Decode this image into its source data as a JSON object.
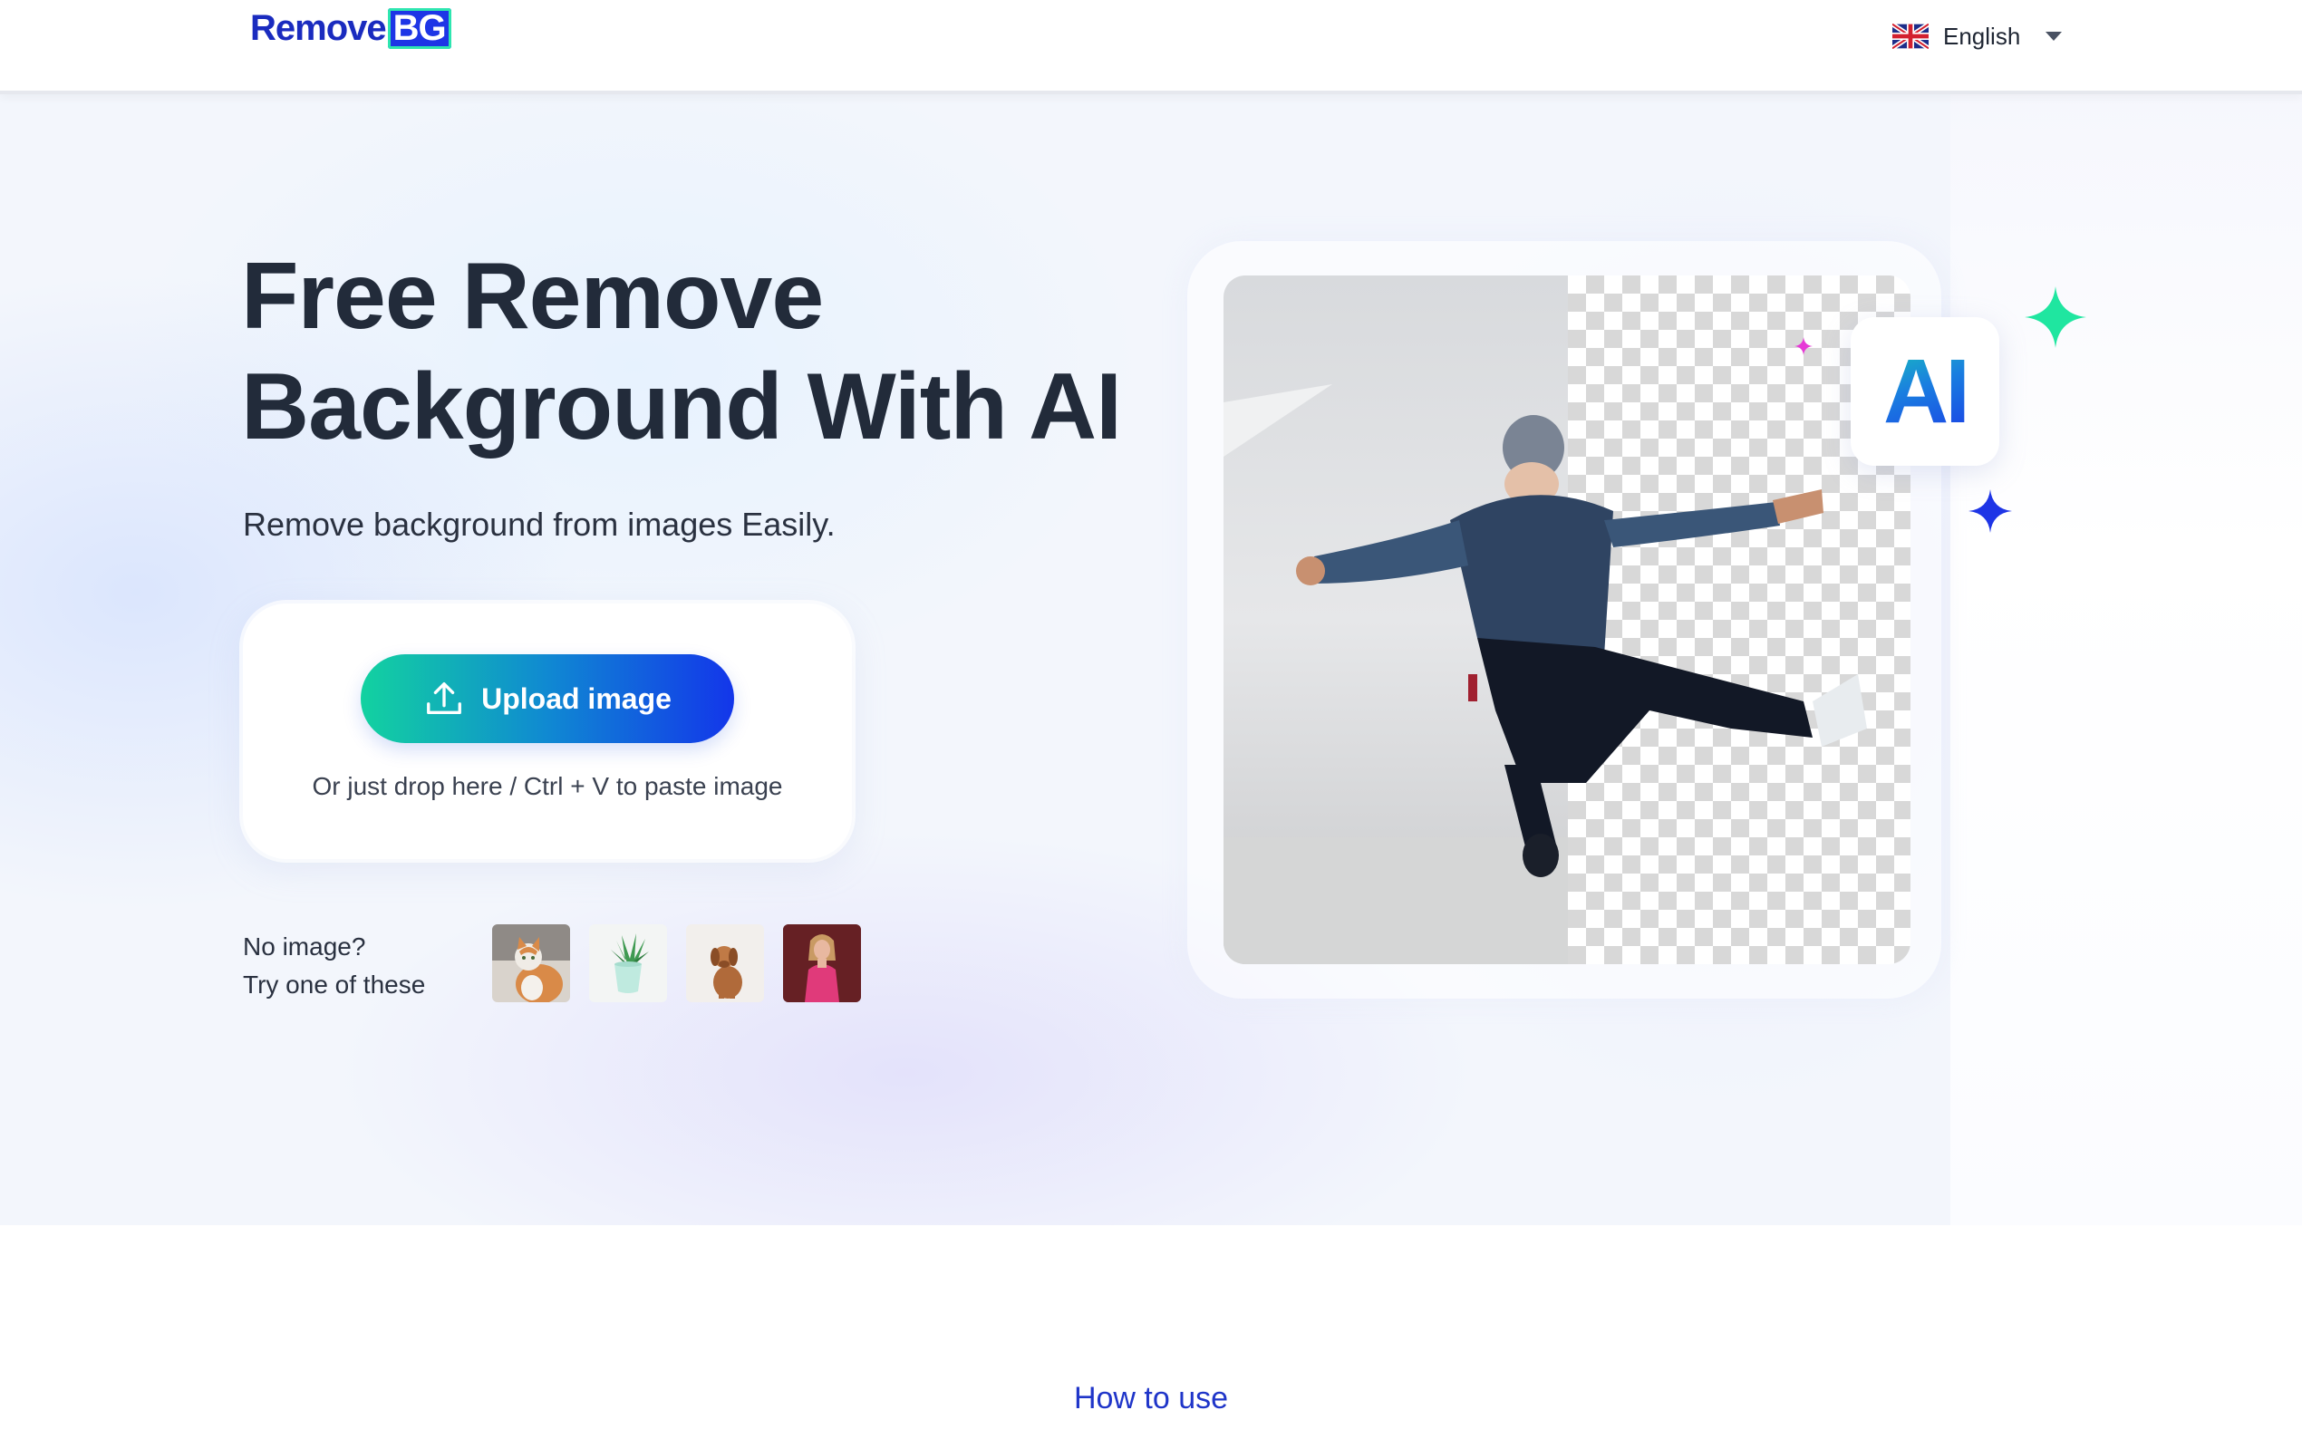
{
  "header": {
    "logo_part1": "Remove",
    "logo_part2": "BG",
    "language": "English"
  },
  "hero": {
    "title_line1": "Free Remove",
    "title_line2": "Background With AI",
    "subtitle": "Remove background from images Easily.",
    "upload_label": "Upload image",
    "drop_hint": "Or just drop here / Ctrl + V to paste image",
    "samples_line1": "No image?",
    "samples_line2": "Try one of these",
    "ai_badge": "AI"
  },
  "sample_images": [
    "cat-thumbnail",
    "plant-thumbnail",
    "puppy-thumbnail",
    "woman-thumbnail"
  ],
  "section_link": "How to use",
  "colors": {
    "brand": "#1e35e6",
    "accent_green": "#12d2a0",
    "title": "#222b3a",
    "link": "#1f35c9"
  }
}
